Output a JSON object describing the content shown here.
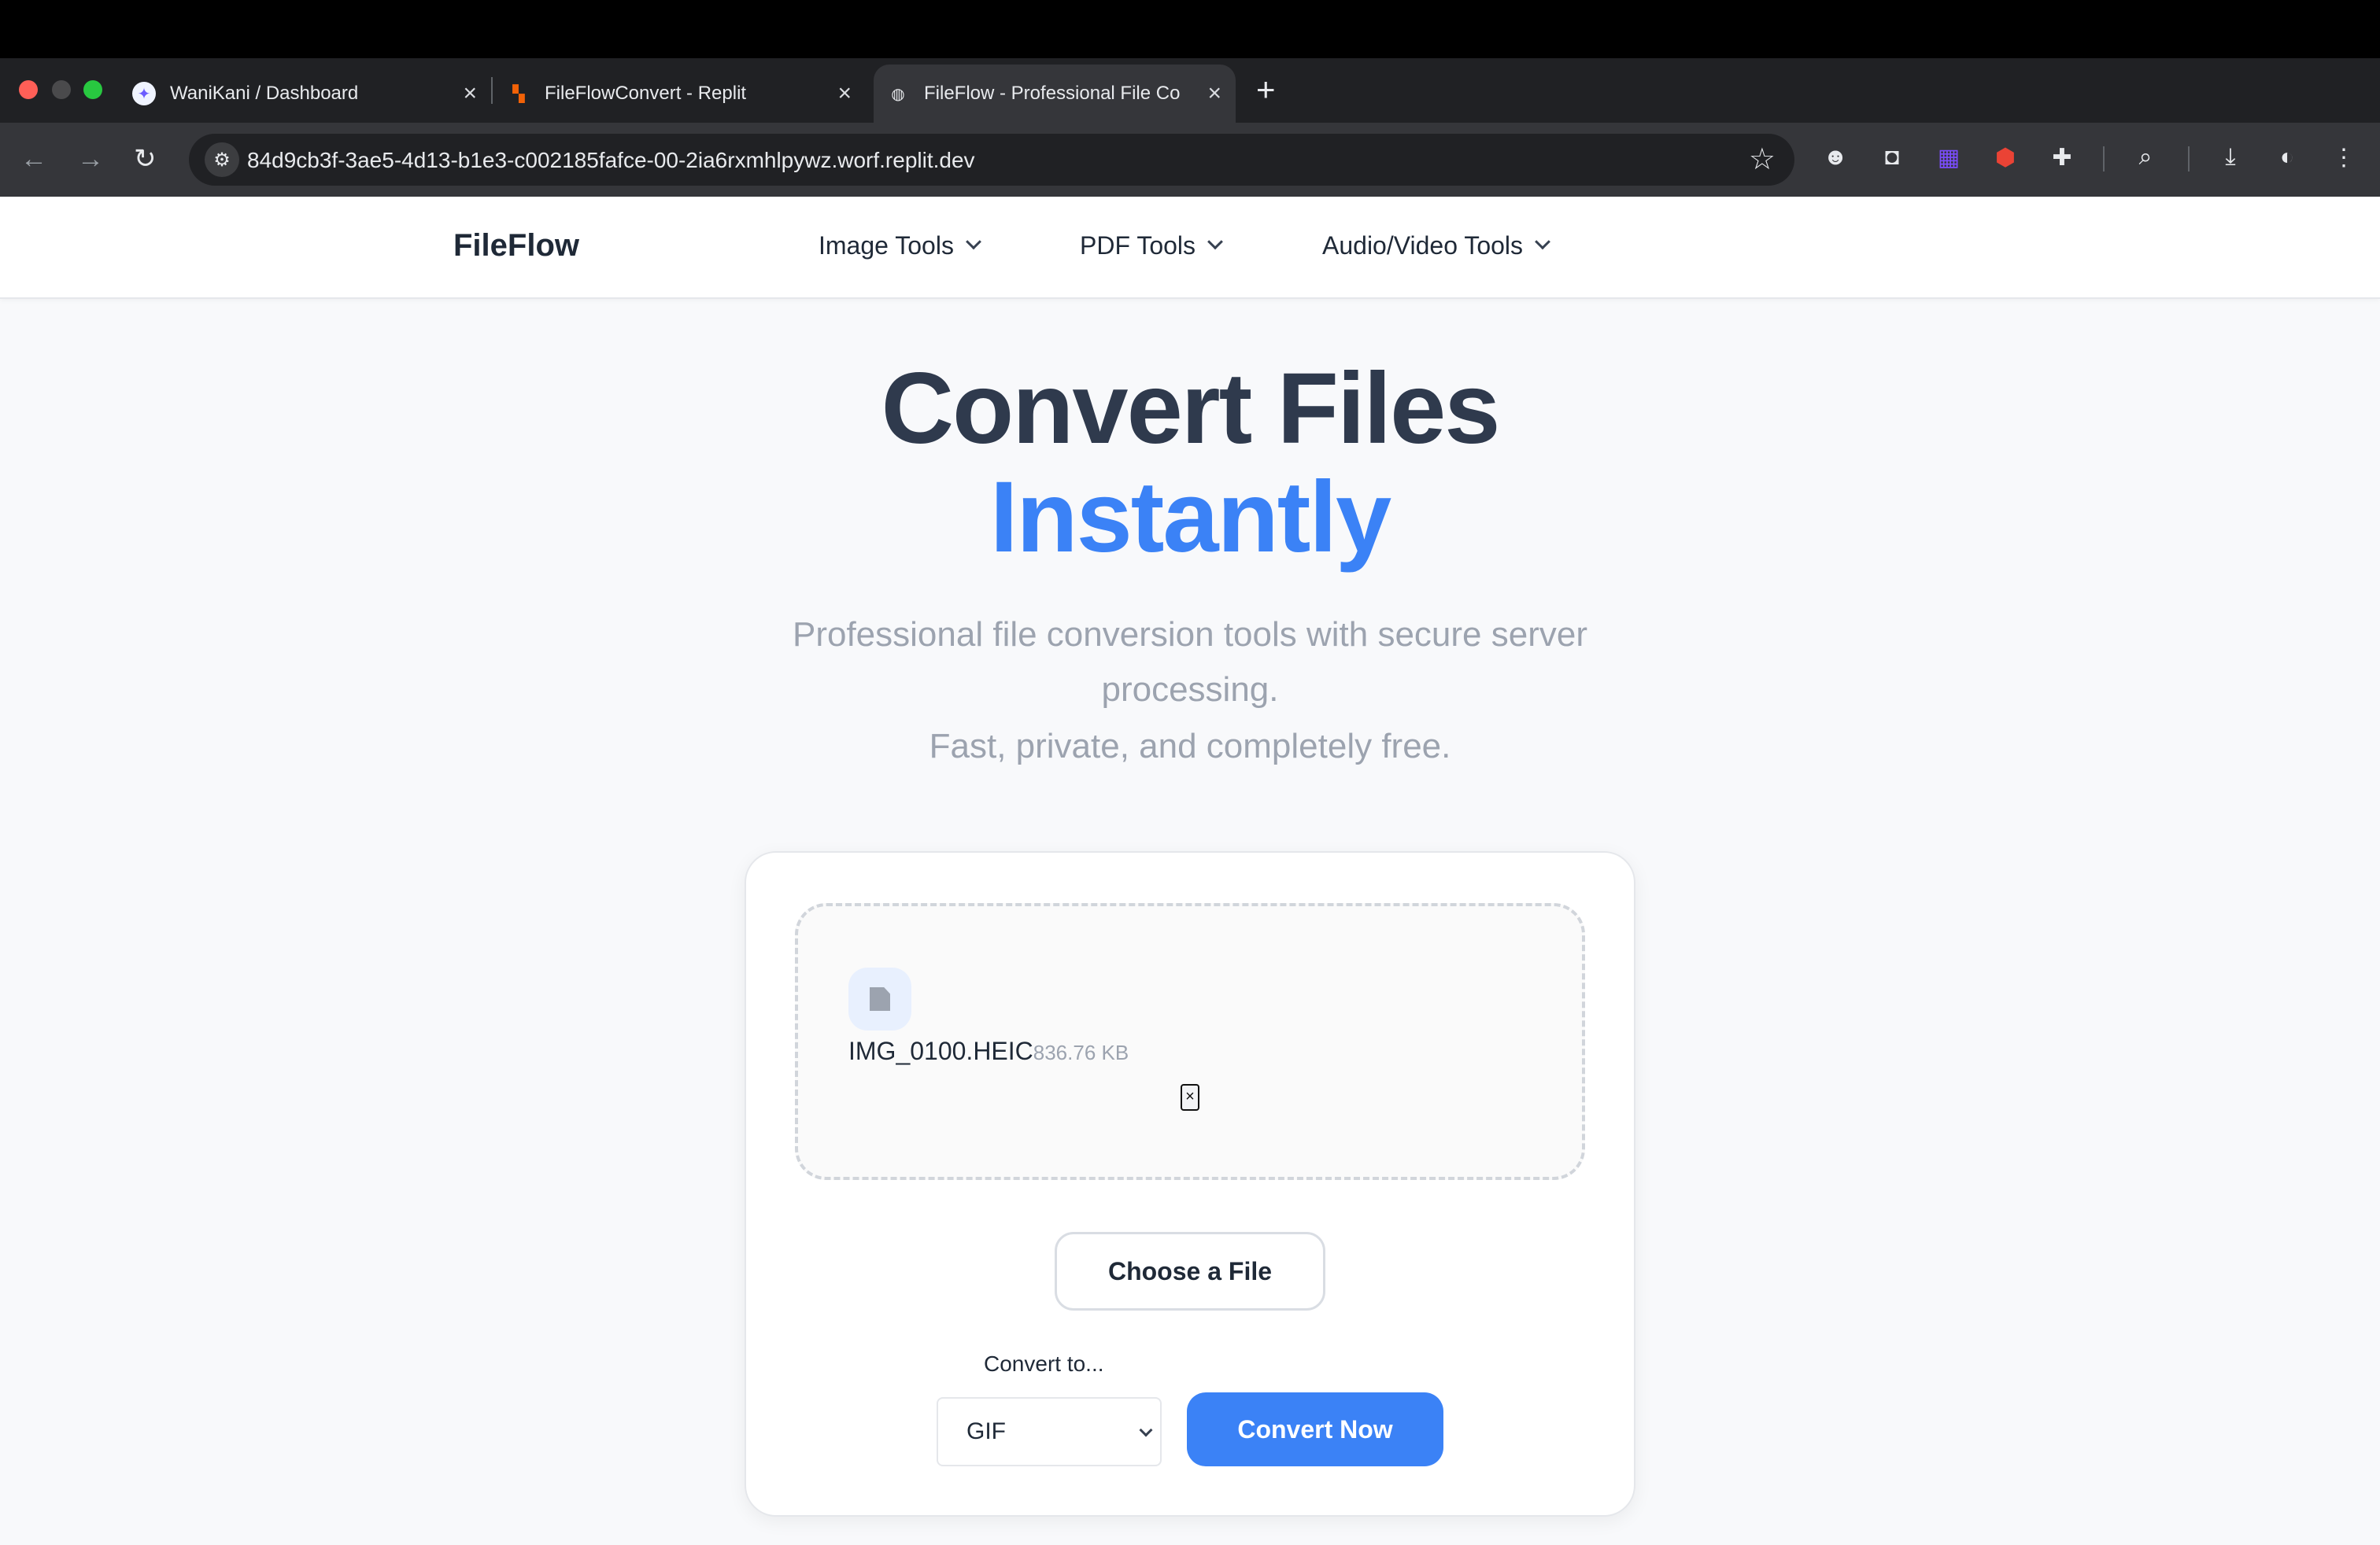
{
  "browser": {
    "tabs": [
      {
        "title": "WaniKani / Dashboard",
        "active": false,
        "favicon": "wanikani-icon"
      },
      {
        "title": "FileFlowConvert - Replit",
        "active": false,
        "favicon": "replit-icon"
      },
      {
        "title": "FileFlow - Professional File Co",
        "active": true,
        "favicon": "globe-icon"
      }
    ],
    "url": "84d9cb3f-3ae5-4d13-b1e3-c002185fafce-00-2ia6rxmhlpywz.worf.replit.dev",
    "extensions": [
      "octocat-icon",
      "reader-icon",
      "tasks-icon",
      "adblock-icon",
      "puzzle-icon",
      "lens-icon",
      "download-icon",
      "profile-avatar"
    ],
    "colors": {
      "chrome": "#202124",
      "toolbar": "#35363a"
    }
  },
  "site": {
    "brand": "FileFlow",
    "nav": [
      {
        "label": "Image Tools"
      },
      {
        "label": "PDF Tools"
      },
      {
        "label": "Audio/Video Tools"
      }
    ]
  },
  "hero": {
    "title_line1": "Convert Files",
    "title_line2": "Instantly",
    "subtitle_line1": "Professional file conversion tools with secure server processing.",
    "subtitle_line2": "Fast, private, and completely free.",
    "accent_color": "#3b82f6"
  },
  "converter": {
    "file": {
      "name": "IMG_0100.HEIC",
      "size": "836.76 KB"
    },
    "remove_label": "×",
    "choose_label": "Choose a File",
    "convert_to_label": "Convert to...",
    "selected_format": "GIF",
    "convert_label": "Convert Now"
  }
}
